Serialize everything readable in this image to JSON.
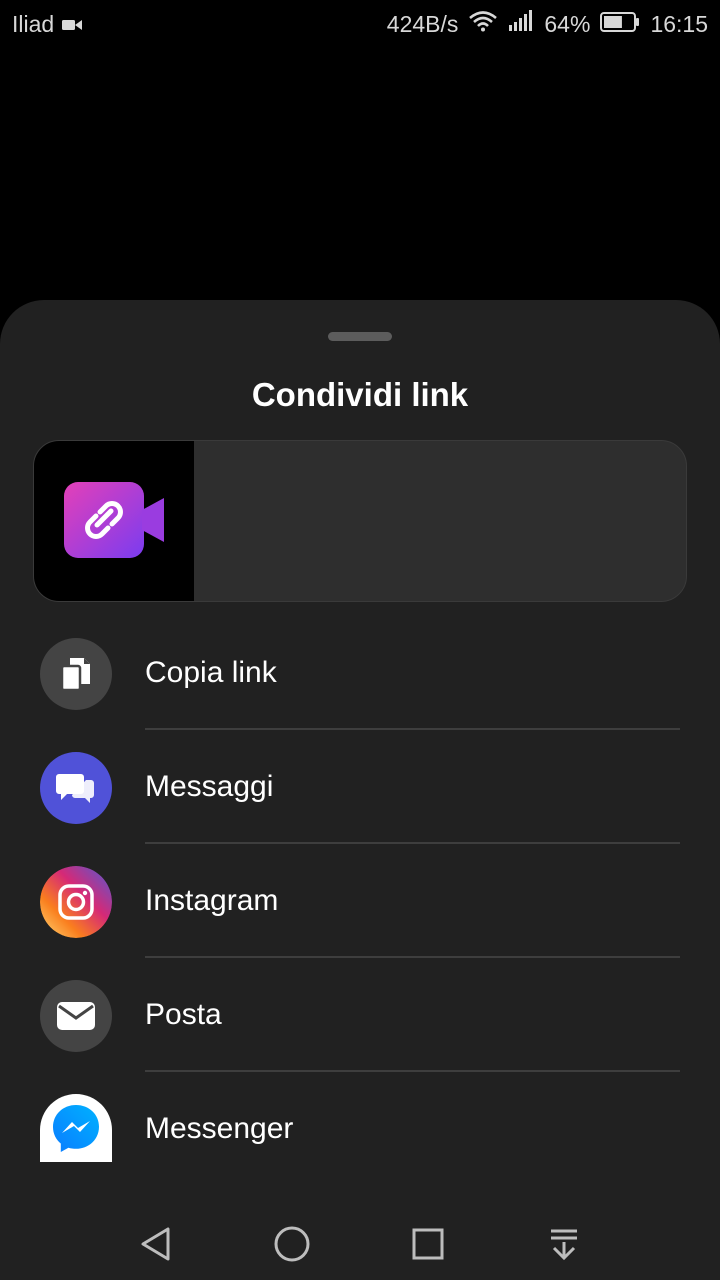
{
  "status_bar": {
    "carrier": "Iliad",
    "net_speed": "424B/s",
    "battery_percent": "64%",
    "battery_level": 0.64,
    "time": "16:15",
    "icons": [
      "video-camera-icon",
      "wifi-icon",
      "signal-icon",
      "battery-icon"
    ]
  },
  "sheet": {
    "title": "Condividi link",
    "preview": {
      "thumb_icon": "link-video-icon"
    },
    "items": [
      {
        "label": "Copia link",
        "icon": "copy-icon",
        "color": "#444444"
      },
      {
        "label": "Messaggi",
        "icon": "chat-bubbles-icon",
        "color": "#5052d8"
      },
      {
        "label": "Instagram",
        "icon": "instagram-icon",
        "color": "#d62976"
      },
      {
        "label": "Posta",
        "icon": "mail-icon",
        "color": "#444444"
      },
      {
        "label": "Messenger",
        "icon": "messenger-icon",
        "color": "#ffffff"
      }
    ]
  },
  "nav_bar": {
    "buttons": [
      "back-icon",
      "home-icon",
      "recents-icon",
      "notification-pull-icon"
    ]
  },
  "colors": {
    "background": "#000000",
    "sheet": "#212121",
    "card": "#2e2e2e",
    "divider": "#3e3e3e",
    "text": "#ffffff"
  }
}
